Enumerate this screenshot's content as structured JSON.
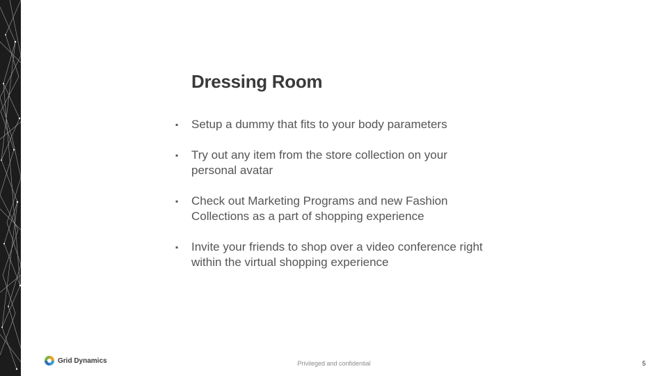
{
  "slide": {
    "title": "Dressing Room",
    "bullets": [
      {
        "lines": [
          "Setup a dummy that fits to your body parameters"
        ]
      },
      {
        "lines": [
          "Try out any item from the store collection on your",
          "personal avatar"
        ]
      },
      {
        "lines": [
          "Check out Marketing Programs and new Fashion",
          "Collections as a part of shopping experience"
        ]
      },
      {
        "lines": [
          "Invite your friends to shop over a video conference right",
          "within the virtual shopping experience"
        ]
      }
    ],
    "bullet_glyph": "▪"
  },
  "footer": {
    "logo_text": "Grid Dynamics",
    "note": "Privileged and confidential",
    "page_number": "5"
  },
  "colors": {
    "title": "#3a3a3a",
    "body_text": "#555555",
    "side_strip": "#1c1c1c"
  }
}
